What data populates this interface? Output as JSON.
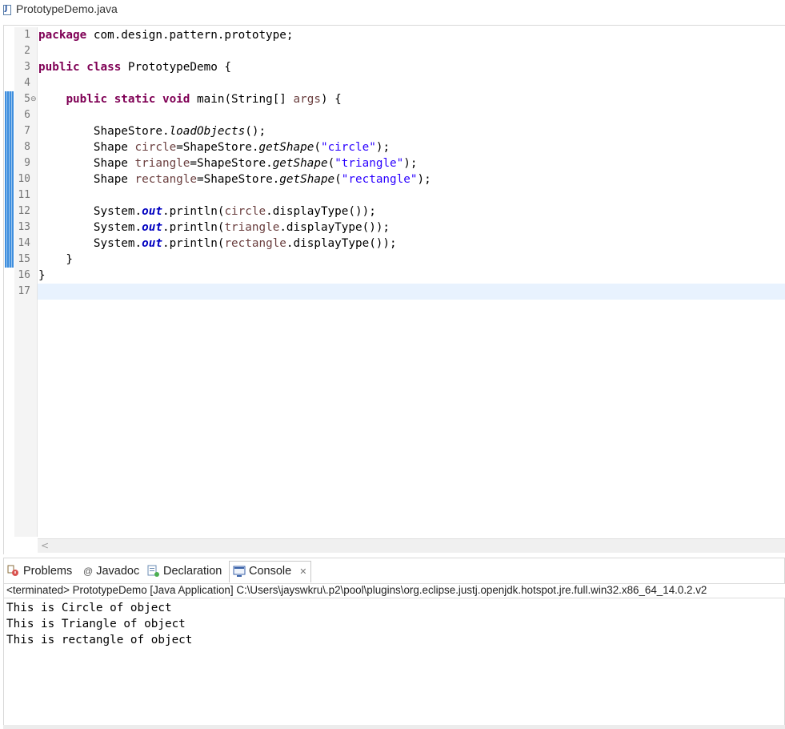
{
  "editor_tab": {
    "title": "PrototypeDemo.java",
    "icon": "java-file-icon"
  },
  "gutter": {
    "line_numbers": [
      "1",
      "2",
      "3",
      "4",
      "5",
      "6",
      "7",
      "8",
      "9",
      "10",
      "11",
      "12",
      "13",
      "14",
      "15",
      "16",
      "17"
    ]
  },
  "code_lines": [
    "package com.design.pattern.prototype;",
    "",
    "public class PrototypeDemo {",
    "",
    "    public static void main(String[] args) {",
    "",
    "        ShapeStore.loadObjects();",
    "        Shape circle=ShapeStore.getShape(\"circle\");",
    "        Shape triangle=ShapeStore.getShape(\"triangle\");",
    "        Shape rectangle=ShapeStore.getShape(\"rectangle\");",
    "",
    "        System.out.println(circle.displayType());",
    "        System.out.println(triangle.displayType());",
    "        System.out.println(rectangle.displayType());",
    "    }",
    "}",
    ""
  ],
  "tokens": {
    "l1": {
      "kw": "package",
      "rest": " com.design.pattern.prototype;"
    },
    "l3": {
      "kw1": "public",
      "kw2": "class",
      "rest": " PrototypeDemo {"
    },
    "l5": {
      "indent": "    ",
      "kw1": "public",
      "kw2": "static",
      "kw3": "void",
      "rest1": " main(String[] ",
      "param": "args",
      "rest2": ") {"
    },
    "l7": {
      "indent": "        ",
      "cls": "ShapeStore.",
      "meth": "loadObjects",
      "rest": "();"
    },
    "l8": {
      "indent": "        ",
      "type": "Shape ",
      "var": "circle",
      "eq": "=ShapeStore.",
      "meth": "getShape",
      "open": "(",
      "str": "\"circle\"",
      "close": ");"
    },
    "l9": {
      "indent": "        ",
      "type": "Shape ",
      "var": "triangle",
      "eq": "=ShapeStore.",
      "meth": "getShape",
      "open": "(",
      "str": "\"triangle\"",
      "close": ");"
    },
    "l10": {
      "indent": "        ",
      "type": "Shape ",
      "var": "rectangle",
      "eq": "=ShapeStore.",
      "meth": "getShape",
      "open": "(",
      "str": "\"rectangle\"",
      "close": ");"
    },
    "l12": {
      "indent": "        ",
      "sys": "System.",
      "out": "out",
      "pl": ".println(",
      "var": "circle",
      "rest": ".displayType());"
    },
    "l13": {
      "indent": "        ",
      "sys": "System.",
      "out": "out",
      "pl": ".println(",
      "var": "triangle",
      "rest": ".displayType());"
    },
    "l14": {
      "indent": "        ",
      "sys": "System.",
      "out": "out",
      "pl": ".println(",
      "var": "rectangle",
      "rest": ".displayType());"
    },
    "l15": "    }",
    "l16": "}"
  },
  "views": {
    "tabs": [
      {
        "label": "Problems",
        "icon": "problems-icon"
      },
      {
        "label": "Javadoc",
        "icon": "at-icon"
      },
      {
        "label": "Declaration",
        "icon": "declaration-icon"
      },
      {
        "label": "Console",
        "icon": "console-icon",
        "active": true
      }
    ],
    "close_glyph": "✕"
  },
  "console": {
    "status": "<terminated> PrototypeDemo [Java Application] C:\\Users\\jayswkru\\.p2\\pool\\plugins\\org.eclipse.justj.openjdk.hotspot.jre.full.win32.x86_64_14.0.2.v2",
    "output": [
      "This is Circle of object",
      "This is Triangle of object",
      "This is rectangle of object"
    ]
  },
  "colors": {
    "keyword": "#7f0055",
    "string": "#2a00ff",
    "local_var": "#6a3e3e",
    "static_field": "#0000c0",
    "current_line": "#e8f2fe"
  }
}
